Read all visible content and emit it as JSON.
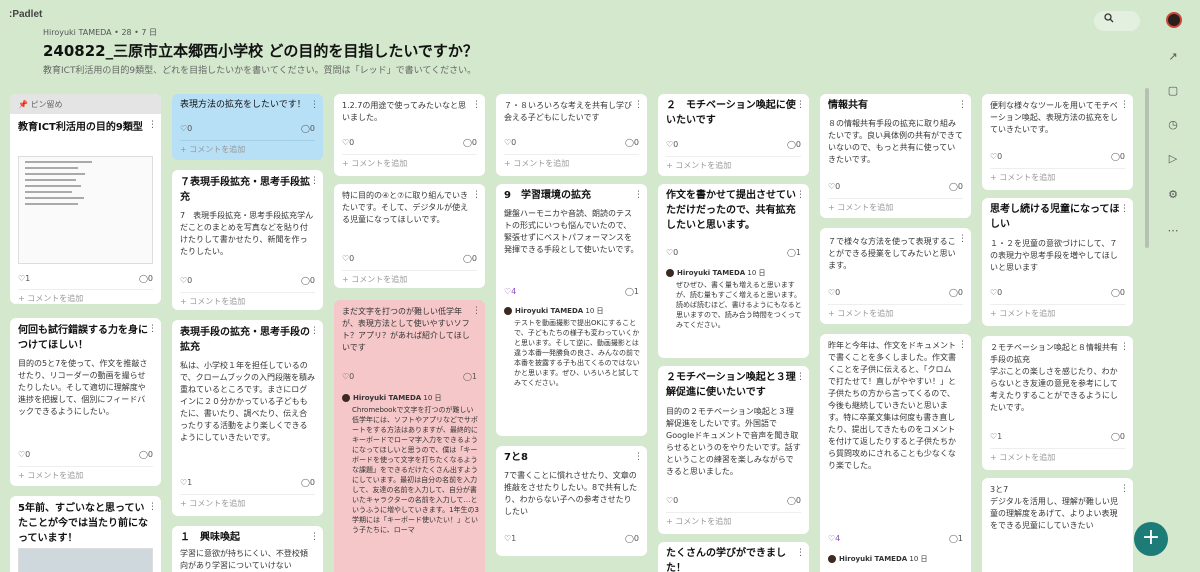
{
  "app": {
    "logo": ":Padlet"
  },
  "header": {
    "meta": "Hiroyuki TAMEDA • 28 • 7 日",
    "title": "240822_三原市立本郷西小学校 どの目的を目指したいですか？",
    "subtitle": "教育ICT利活用の目的9類型、どれを目指したいかを書いてください。質問は「レッド」で書いてください。"
  },
  "ui": {
    "menu": "⋮",
    "add_comment": "+ コメントを追加",
    "heart": "♡",
    "comment_icon": "◯",
    "pin_label": "📌 ピン留め"
  },
  "cards": {
    "c1_1": {
      "title": "教育ICT利活用の目的9類型",
      "react": "1",
      "comments": "0"
    },
    "c1_2": {
      "title": "何回も試行錯誤する力を身につけてほしい！",
      "body": "目的の5と7を使って、作文を推敲させたり、リコーダーの動画を撮らせたりしたい。そして適切に理解度や進捗を把握して、個別にフィードバックできるようにしたい。",
      "react": "0",
      "comments": "0"
    },
    "c1_3": {
      "title": "5年前、すごいなと思っていたことが今では当たり前になっています！"
    },
    "c2_1": {
      "title": "表現方法の拡充をしたいです！",
      "react": "0",
      "comments": "0"
    },
    "c2_2": {
      "title": "７表現手段拡充・思考手段拡充",
      "body": "7　表現手段拡充・思考手段拡充学んだことのまとめを写真などを貼り付けたりして書かせたり、新聞を作ったりしたい。",
      "react": "0",
      "comments": "0"
    },
    "c2_3": {
      "title": "表現手段の拡充・思考手段の拡充",
      "body": "私は、小学校１年を担任しているので、クロームブックの入門段階を積み重ねているところです。まさにログインに２０分かかっている子どももたに、書いたり、調べたり、伝え合ったりする活動をより楽しくできるようにしていきたいです。",
      "react": "1",
      "comments": "0"
    },
    "c2_4": {
      "title": "１　興味喚起",
      "body": "学習に意欲が持ちにくい、不登校傾向があり学習についていけない"
    },
    "c3_1": {
      "body": "1.2.7の用途で使ってみたいなと思いました。",
      "react": "0",
      "comments": "0"
    },
    "c3_2": {
      "body": "特に目的の④と⑦に取り組んでいきたいです。そして、デジタルが使える児童になってほしいです。",
      "react": "0",
      "comments": "0"
    },
    "c3_3": {
      "body": "まだ文字を打つのが難しい低学年が、表現方法として使いやすいソフト？アプリ？があれば紹介してほしいです",
      "react": "0",
      "comments": "1",
      "commenter": "Hiroyuki TAMEDA",
      "comment_time": "10 日",
      "comment": "Chromebookで文字を打つのが難しい低学年には、ソフトやアプリなどでサポートをする方法はありますが、最終的にキーボードでローマ字入力をできるようになってほしいと思うので、僕は「キーボードを使って文字を打ちたくなるような課題」をできるだけたくさん出すようにしています。最初は自分の名前を入力して、友達の名前を入力して、自分が書いたキャラクターの名前を入力して…というふうに増やしていきます。1年生の3学期には「キーボード使いたい！」という子たちに、ローマ"
    },
    "c4_1": {
      "body": "７・８いろいろな考えを共有し学び会える子どもにしたいです",
      "react": "0",
      "comments": "0"
    },
    "c4_2": {
      "title": "9　学習環境の拡充",
      "body": "鍵盤ハーモニカや音読、朗読のテストの形式にいつも悩んでいたので、緊張せずにベストパフォーマンスを発揮できる手段として使いたいです。",
      "react": "4",
      "comments": "1",
      "commenter": "Hiroyuki TAMEDA",
      "comment_time": "10 日",
      "comment": "テストを動画撮影で提出OKにすることで、子どもたちの様子も変わっていくかと思います。そして逆に、動画撮影とは違う本番一発勝負の良さ、みんなの前で本番を披露する子も出てくるのではないかと思います。ぜひ、いろいろと試してみてください。"
    },
    "c4_3": {
      "title": "7と8",
      "body": "7で書くことに慣れさせたり、文章の推敲をさせたりしたい。8で共有したり、わからない子への参考させたりしたい",
      "react": "1",
      "comments": "0"
    },
    "c5_1": {
      "title": "２　モチベーション喚起に使いたいです",
      "react": "0",
      "comments": "0"
    },
    "c5_2": {
      "title": "作文を書かせて提出させていただけだったので、共有拡充したいと思います。",
      "react": "0",
      "comments": "1",
      "commenter": "Hiroyuki TAMEDA",
      "comment_time": "10 日",
      "comment": "ぜひぜひ、書く量も増えると思いますが、読む量もすごく増えると思います。読めば読むほど、書けるようにもなると思いますので、読み合う時間をつくってみてください。"
    },
    "c5_3": {
      "title": "２モチベーション喚起と３理解促進に使いたいです",
      "body": "目的の２モチベーション喚起と３理解促進をしたいです。外国語でGoogleドキュメントで音声を聞き取らせるというのをやりたいです。話すということの練習を楽しみながらできると思いました。",
      "react": "0",
      "comments": "0"
    },
    "c5_4": {
      "title": "たくさんの学びができました！"
    },
    "c6_1": {
      "title": "情報共有",
      "body": "８の情報共有手段の拡充に取り組みたいです。良い具体例の共有ができていないので、もっと共有に使っていきたいです。",
      "react": "0",
      "comments": "0"
    },
    "c6_2": {
      "body": "７で様々な方法を使って表現することができる授業をしてみたいと思います。",
      "react": "0",
      "comments": "0"
    },
    "c6_3": {
      "body": "昨年と今年は、作文をドキュメントで書くことを多くしました。作文書くことを子供に伝えると、「クロムで打たせて！直しがややすい！」と子供たちの方から言ってくるので、今後も継続していきたいと思います。特に卒業文集は何度も書き直したり、提出してきたものをコメントを付けて返したりすると子供たちから質問攻めにされることも少なくなり楽でした。",
      "react": "4",
      "comments": "1",
      "commenter": "Hiroyuki TAMEDA",
      "comment_time": "10 日"
    },
    "c7_1": {
      "body": "便利な様々なツールを用いてモチベーション喚起、表現方法の拡充をしていきたいです。",
      "react": "0",
      "comments": "0"
    },
    "c7_2": {
      "title": "思考し続ける児童になってほしい",
      "body": "１・２を児童の意欲づけにして、７の表現力や思考手段を増やしてほしいと思います",
      "react": "0",
      "comments": "0"
    },
    "c7_3": {
      "body": "２モチベーション喚起と８情報共有手段の拡充\n学ぶことの楽しさを感じたり、わからないとき友達の意見を参考にして考えたりすることができるようにしたいです。",
      "react": "1",
      "comments": "0"
    },
    "c7_4": {
      "body": "3と7\nデジタルを活用し、理解が難しい児童の理解度をあげて、よりよい表現をできる児童にしていきたい"
    }
  }
}
